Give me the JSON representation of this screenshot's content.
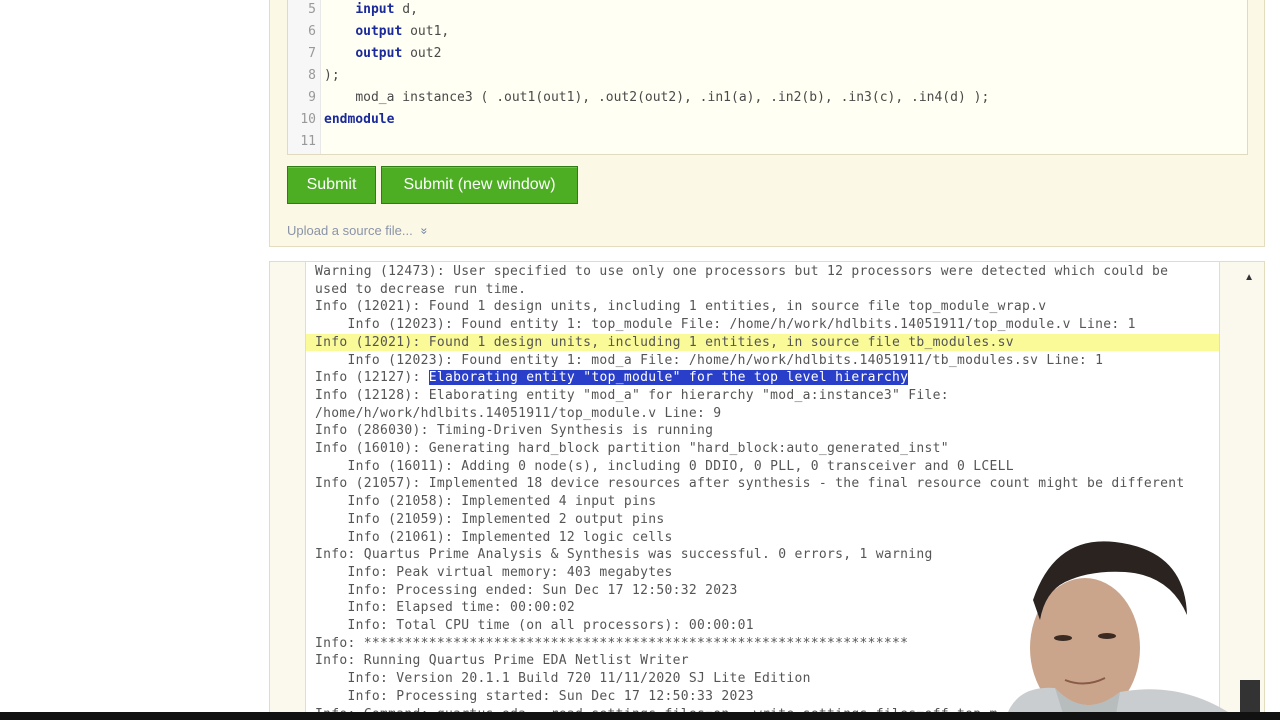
{
  "editor": {
    "lines": [
      {
        "num": "5",
        "kw": "input",
        "rest": " d,",
        "indent": "    "
      },
      {
        "num": "6",
        "kw": "output",
        "rest": " out1,",
        "indent": "    "
      },
      {
        "num": "7",
        "kw": "output",
        "rest": " out2",
        "indent": "    "
      },
      {
        "num": "8",
        "kw": "",
        "rest": ");",
        "indent": ""
      },
      {
        "num": "9",
        "kw": "",
        "rest": "mod_a instance3 ( .out1(out1), .out2(out2), .in1(a), .in2(b), .in3(c), .in4(d) );",
        "indent": "    "
      },
      {
        "num": "10",
        "kw": "endmodule",
        "rest": "",
        "indent": ""
      },
      {
        "num": "11",
        "kw": "",
        "rest": "",
        "indent": ""
      }
    ]
  },
  "buttons": {
    "submit": "Submit",
    "submit_new_window": "Submit (new window)"
  },
  "upload": {
    "label": "Upload a source file...",
    "chevron": "»"
  },
  "log": {
    "lines": [
      "Warning (12473): User specified to use only one processors but 12 processors were detected which could be",
      "used to decrease run time.",
      "Info (12021): Found 1 design units, including 1 entities, in source file top_module_wrap.v",
      "    Info (12023): Found entity 1: top_module File: /home/h/work/hdlbits.14051911/top_module.v Line: 1",
      "Info (12021): Found 1 design units, including 1 entities, in source file tb_modules.sv",
      "    Info (12023): Found entity 1: mod_a File: /home/h/work/hdlbits.14051911/tb_modules.sv Line: 1",
      "Info (12127): ",
      "Info (12128): Elaborating entity \"mod_a\" for hierarchy \"mod_a:instance3\" File:",
      "/home/h/work/hdlbits.14051911/top_module.v Line: 9",
      "Info (286030): Timing-Driven Synthesis is running",
      "Info (16010): Generating hard_block partition \"hard_block:auto_generated_inst\"",
      "    Info (16011): Adding 0 node(s), including 0 DDIO, 0 PLL, 0 transceiver and 0 LCELL",
      "Info (21057): Implemented 18 device resources after synthesis - the final resource count might be different",
      "    Info (21058): Implemented 4 input pins",
      "    Info (21059): Implemented 2 output pins",
      "    Info (21061): Implemented 12 logic cells",
      "Info: Quartus Prime Analysis & Synthesis was successful. 0 errors, 1 warning",
      "    Info: Peak virtual memory: 403 megabytes",
      "    Info: Processing ended: Sun Dec 17 12:50:32 2023",
      "    Info: Elapsed time: 00:00:02",
      "    Info: Total CPU time (on all processors): 00:00:01",
      "Info: *******************************************************************",
      "Info: Running Quartus Prime EDA Netlist Writer",
      "    Info: Version 20.1.1 Build 720 11/11/2020 SJ Lite Edition",
      "    Info: Processing started: Sun Dec 17 12:50:33 2023",
      "Info: Command: quartus_eda --read_settings_files=on --write_settings_files=off top_m"
    ],
    "highlighted_line_index": 4,
    "selected_line_index": 6,
    "selected_text": "Elaborating entity \"top_module\" for the top level hierarchy"
  },
  "colors": {
    "button_green": "#4dae24",
    "highlight_yellow": "#fafa98",
    "selection_blue": "#2a3fc9",
    "keyword_blue": "#1b2a9a"
  }
}
